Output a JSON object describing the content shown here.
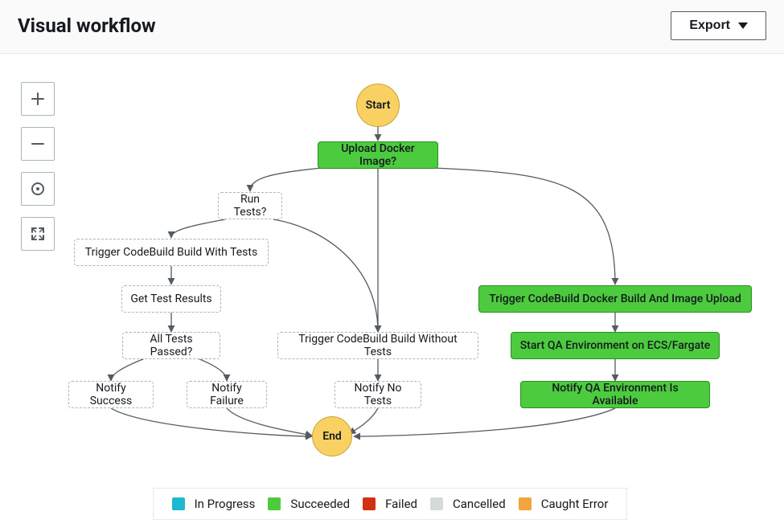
{
  "header": {
    "title": "Visual workflow",
    "export_label": "Export"
  },
  "nodes": {
    "start": "Start",
    "end": "End",
    "upload_docker": "Upload Docker Image?",
    "run_tests": "Run Tests?",
    "trigger_with_tests": "Trigger CodeBuild Build With Tests",
    "get_results": "Get Test Results",
    "all_passed": "All Tests Passed?",
    "notify_success": "Notify Success",
    "notify_failure": "Notify Failure",
    "trigger_without_tests": "Trigger CodeBuild Build Without Tests",
    "notify_no_tests": "Notify No Tests",
    "trigger_docker": "Trigger CodeBuild Docker Build And Image Upload",
    "start_qa": "Start QA Environment on ECS/Fargate",
    "notify_qa": "Notify QA Environment Is Available"
  },
  "legend": [
    {
      "label": "In Progress",
      "color": "#1fb8d1"
    },
    {
      "label": "Succeeded",
      "color": "#4CCB3E"
    },
    {
      "label": "Failed",
      "color": "#d13212"
    },
    {
      "label": "Cancelled",
      "color": "#d5dbdb"
    },
    {
      "label": "Caught Error",
      "color": "#f2a53c"
    }
  ],
  "status_colors": {
    "in_progress": "#1fb8d1",
    "succeeded": "#4CCB3E",
    "failed": "#d13212",
    "cancelled": "#d5dbdb",
    "caught_error": "#f2a53c"
  }
}
